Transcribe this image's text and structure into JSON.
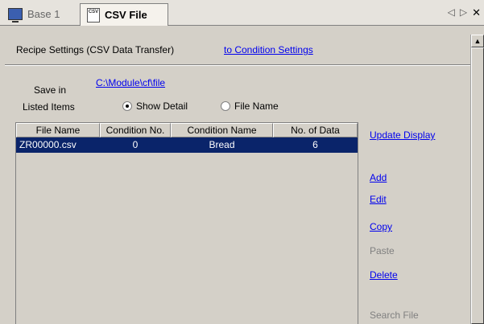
{
  "tabs": [
    {
      "label": "Base 1",
      "icon": "monitor-icon",
      "active": false
    },
    {
      "label": "CSV File",
      "icon": "csv-file-icon",
      "active": true
    }
  ],
  "tab_nav": {
    "prev": "◁",
    "next": "▷",
    "close": "✕"
  },
  "header": {
    "title": "Recipe Settings (CSV Data Transfer)",
    "link": "to Condition Settings"
  },
  "save": {
    "label": "Save in",
    "path": "C:\\Module\\cf\\file"
  },
  "listed": {
    "label": "Listed Items",
    "options": [
      {
        "label": "Show Detail",
        "checked": true
      },
      {
        "label": "File Name",
        "checked": false
      }
    ]
  },
  "table": {
    "columns": [
      "File Name",
      "Condition No.",
      "Condition Name",
      "No. of Data"
    ],
    "rows": [
      {
        "file": "ZR00000.csv",
        "cond_no": "0",
        "cond_name": "Bread",
        "count": "6",
        "selected": true
      }
    ]
  },
  "side_actions": {
    "update_display": "Update Display",
    "add": "Add",
    "edit": "Edit",
    "copy": "Copy",
    "paste": "Paste",
    "delete": "Delete",
    "search_file": "Search File"
  },
  "colors": {
    "selection": "#0a246a",
    "link": "#0000ee",
    "disabled": "#808080"
  }
}
